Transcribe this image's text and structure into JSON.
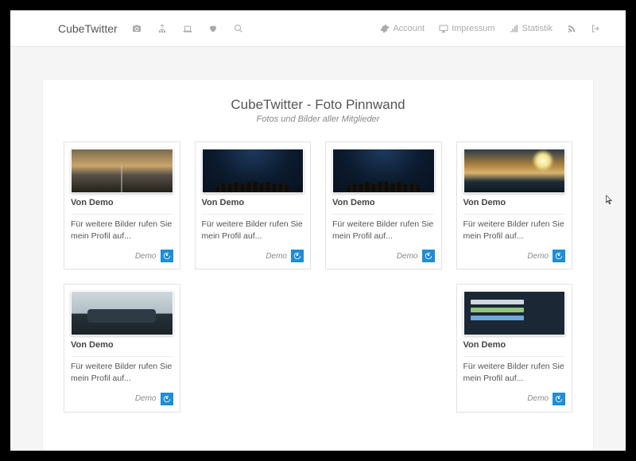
{
  "brand": "CubeTwitter",
  "nav_right": {
    "account": "Account",
    "impressum": "Impressum",
    "statistik": "Statistik"
  },
  "page": {
    "title": "CubeTwitter - Foto Pinnwand",
    "subtitle": "Fotos und Bilder aller Mitglieder"
  },
  "card_common": {
    "author_prefix": "Von Demo",
    "text": "Für weitere Bilder rufen Sie mein Profil auf...",
    "footer_label": "Demo"
  },
  "cards": [
    {
      "thumb": "thumb-road"
    },
    {
      "thumb": "thumb-night"
    },
    {
      "thumb": "thumb-night"
    },
    {
      "thumb": "thumb-mtn"
    },
    {
      "thumb": "thumb-car"
    },
    {
      "thumb": "empty"
    },
    {
      "thumb": "empty"
    },
    {
      "thumb": "thumb-code"
    }
  ]
}
